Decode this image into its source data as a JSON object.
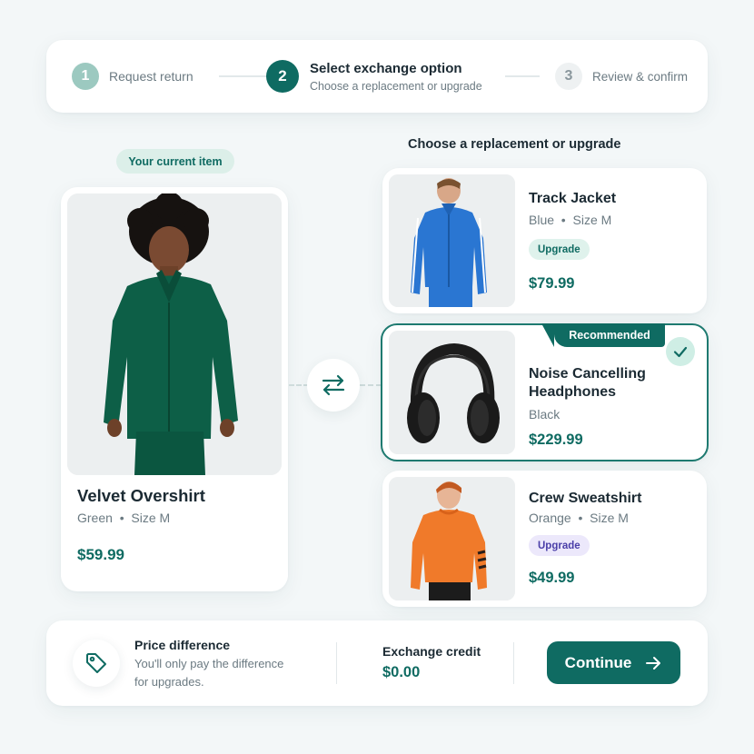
{
  "stepper": {
    "steps": [
      {
        "number": "1",
        "label": "Request return",
        "status": "completed"
      },
      {
        "number": "2",
        "label": "Select exchange option",
        "subtitle": "Choose a replacement or upgrade",
        "status": "active"
      },
      {
        "number": "3",
        "label": "Review & confirm",
        "status": "upcoming"
      }
    ]
  },
  "current_item": {
    "badge": "Your current item",
    "name": "Velvet Overshirt",
    "color": "Green",
    "size": "Size M",
    "price": "$59.99"
  },
  "options": {
    "title": "Choose a replacement or upgrade",
    "items": [
      {
        "name": "Track Jacket",
        "color": "Blue",
        "size": "Size M",
        "tag": "Upgrade",
        "price": "$79.99"
      },
      {
        "name_line1": "Noise Cancelling",
        "name_line2": "Headphones",
        "color": "Black",
        "badge": "Recommended",
        "price": "$229.99",
        "selected": true
      },
      {
        "name": "Crew Sweatshirt",
        "color": "Orange",
        "size": "Size M",
        "tag": "Upgrade",
        "price": "$49.99"
      }
    ]
  },
  "summary": {
    "price_difference_title": "Price difference",
    "price_difference_desc": "You'll only pay the difference for upgrades.",
    "exchange_credit_title": "Exchange credit",
    "exchange_credit_value": "$0.00",
    "continue_label": "Continue"
  },
  "icons": {
    "swap": "swap-arrows-icon",
    "check": "check-icon",
    "price_tag": "price-tag-icon",
    "arrow_right": "arrow-right-icon"
  },
  "colors": {
    "accent": "#0f6b62",
    "accent_light": "#dcefe9",
    "upgrade_purple": "#4a3ea8",
    "background": "#f3f7f8"
  }
}
